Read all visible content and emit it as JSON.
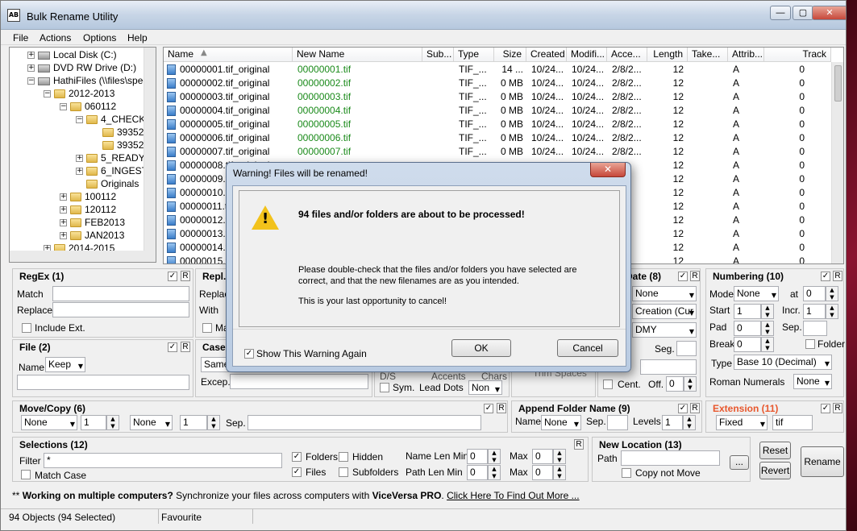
{
  "window": {
    "title": "Bulk Rename Utility",
    "icon_text": "AB",
    "controls": [
      "—",
      "▢",
      "✕"
    ]
  },
  "menu": [
    "File",
    "Actions",
    "Options",
    "Help"
  ],
  "tree": [
    {
      "label": "Local Disk (C:)",
      "type": "drive",
      "toggle": "+"
    },
    {
      "label": "DVD RW Drive (D:)",
      "type": "drive",
      "toggle": "+"
    },
    {
      "label": "HathiFiles (\\\\files\\spec",
      "type": "drive",
      "toggle": "−"
    },
    {
      "label": "2012-2013",
      "type": "folder",
      "toggle": "−"
    },
    {
      "label": "060112",
      "type": "folder",
      "toggle": "−"
    },
    {
      "label": "4_CHECK",
      "type": "folder",
      "toggle": "−"
    },
    {
      "label": "39352",
      "type": "folder",
      "toggle": ""
    },
    {
      "label": "39352",
      "type": "folder",
      "toggle": ""
    },
    {
      "label": "5_READY",
      "type": "folder",
      "toggle": "+"
    },
    {
      "label": "6_INGEST",
      "type": "folder",
      "toggle": "+"
    },
    {
      "label": "Originals",
      "type": "folder",
      "toggle": ""
    },
    {
      "label": "100112",
      "type": "folder",
      "toggle": "+"
    },
    {
      "label": "120112",
      "type": "folder",
      "toggle": "+"
    },
    {
      "label": "FEB2013",
      "type": "folder",
      "toggle": "+"
    },
    {
      "label": "JAN2013",
      "type": "folder",
      "toggle": "+"
    },
    {
      "label": "2014-2015",
      "type": "folder",
      "toggle": "+"
    }
  ],
  "columns": [
    "Name",
    "New Name",
    "Sub...",
    "Type",
    "Size",
    "Created",
    "Modifi...",
    "Acce...",
    "Length",
    "Take...",
    "Attrib...",
    "Track"
  ],
  "rows": [
    {
      "name": "00000001.tif_original",
      "new": "00000001.tif",
      "type": "TIF_...",
      "size": "14 ...",
      "created": "10/24...",
      "modified": "10/24...",
      "accessed": "2/8/2...",
      "length": "12",
      "attrib": "A",
      "track": "0"
    },
    {
      "name": "00000002.tif_original",
      "new": "00000002.tif",
      "type": "TIF_...",
      "size": "0 MB",
      "created": "10/24...",
      "modified": "10/24...",
      "accessed": "2/8/2...",
      "length": "12",
      "attrib": "A",
      "track": "0"
    },
    {
      "name": "00000003.tif_original",
      "new": "00000003.tif",
      "type": "TIF_...",
      "size": "0 MB",
      "created": "10/24...",
      "modified": "10/24...",
      "accessed": "2/8/2...",
      "length": "12",
      "attrib": "A",
      "track": "0"
    },
    {
      "name": "00000004.tif_original",
      "new": "00000004.tif",
      "type": "TIF_...",
      "size": "0 MB",
      "created": "10/24...",
      "modified": "10/24...",
      "accessed": "2/8/2...",
      "length": "12",
      "attrib": "A",
      "track": "0"
    },
    {
      "name": "00000005.tif_original",
      "new": "00000005.tif",
      "type": "TIF_...",
      "size": "0 MB",
      "created": "10/24...",
      "modified": "10/24...",
      "accessed": "2/8/2...",
      "length": "12",
      "attrib": "A",
      "track": "0"
    },
    {
      "name": "00000006.tif_original",
      "new": "00000006.tif",
      "type": "TIF_...",
      "size": "0 MB",
      "created": "10/24...",
      "modified": "10/24...",
      "accessed": "2/8/2...",
      "length": "12",
      "attrib": "A",
      "track": "0"
    },
    {
      "name": "00000007.tif_original",
      "new": "00000007.tif",
      "type": "TIF_...",
      "size": "0 MB",
      "created": "10/24...",
      "modified": "10/24...",
      "accessed": "2/8/2...",
      "length": "12",
      "attrib": "A",
      "track": "0"
    },
    {
      "name": "00000008.tif_original",
      "new": "",
      "type": "",
      "size": "",
      "created": "",
      "modified": "",
      "accessed": "",
      "length": "12",
      "attrib": "A",
      "track": "0"
    },
    {
      "name": "00000009.tif_original",
      "new": "",
      "type": "",
      "size": "",
      "created": "",
      "modified": "",
      "accessed": "",
      "length": "12",
      "attrib": "A",
      "track": "0"
    },
    {
      "name": "00000010.tif_original",
      "new": "",
      "type": "",
      "size": "",
      "created": "",
      "modified": "",
      "accessed": "",
      "length": "12",
      "attrib": "A",
      "track": "0"
    },
    {
      "name": "00000011.tif_original",
      "new": "",
      "type": "",
      "size": "",
      "created": "",
      "modified": "",
      "accessed": "",
      "length": "12",
      "attrib": "A",
      "track": "0"
    },
    {
      "name": "00000012.tif_original",
      "new": "",
      "type": "",
      "size": "",
      "created": "",
      "modified": "",
      "accessed": "",
      "length": "12",
      "attrib": "A",
      "track": "0"
    },
    {
      "name": "00000013.tif_original",
      "new": "",
      "type": "",
      "size": "",
      "created": "",
      "modified": "",
      "accessed": "",
      "length": "12",
      "attrib": "A",
      "track": "0"
    },
    {
      "name": "00000014.tif_original",
      "new": "",
      "type": "",
      "size": "",
      "created": "",
      "modified": "",
      "accessed": "",
      "length": "12",
      "attrib": "A",
      "track": "0"
    },
    {
      "name": "00000015.tif_original",
      "new": "",
      "type": "",
      "size": "",
      "created": "",
      "modified": "",
      "accessed": "",
      "length": "12",
      "attrib": "A",
      "track": "0"
    }
  ],
  "regex": {
    "title": "RegEx (1)",
    "match_label": "Match",
    "replace_label": "Replace",
    "include_ext": "Include Ext."
  },
  "repl": {
    "title": "Repl.",
    "replace_label": "Replac",
    "with_label": "With",
    "ma_label": "Ma"
  },
  "file": {
    "title": "File (2)",
    "name_label": "Name",
    "name_value": "Keep"
  },
  "case": {
    "title": "Case",
    "value": "Same",
    "except_label": "Excep."
  },
  "remove_frag": {
    "sym": "Sym.",
    "lead_dots": "Lead Dots",
    "lead_value": "Non",
    "dc": "D/S",
    "accents": "Accents",
    "chars": "Chars",
    "trim": "Trim Spaces"
  },
  "autodate": {
    "title": "Date (8)",
    "mode": "None",
    "type": "Creation (Cur",
    "fmt": "DMY",
    "seg_label": "Seg.",
    "cent": "Cent.",
    "off_label": "Off.",
    "off_value": "0"
  },
  "numbering": {
    "title": "Numbering (10)",
    "mode_label": "Mode",
    "mode_value": "None",
    "at_label": "at",
    "at_value": "0",
    "start_label": "Start",
    "start_value": "1",
    "incr_label": "Incr.",
    "incr_value": "1",
    "pad_label": "Pad",
    "pad_value": "0",
    "sep_label": "Sep.",
    "break_label": "Break",
    "break_value": "0",
    "folder_label": "Folder",
    "type_label": "Type",
    "type_value": "Base 10 (Decimal)",
    "roman_label": "Roman Numerals",
    "roman_value": "None"
  },
  "movecopy": {
    "title": "Move/Copy (6)",
    "sel1": "None",
    "num1": "1",
    "sel2": "None",
    "num2": "1",
    "sep_label": "Sep."
  },
  "append": {
    "title": "Append Folder Name (9)",
    "name_label": "Name",
    "name_value": "None",
    "sep_label": "Sep.",
    "levels_label": "Levels",
    "levels_value": "1"
  },
  "extension": {
    "title": "Extension (11)",
    "mode": "Fixed",
    "value": "tif"
  },
  "selections": {
    "title": "Selections (12)",
    "filter_label": "Filter",
    "filter_value": "*",
    "match_case": "Match Case",
    "folders": "Folders",
    "hidden": "Hidden",
    "files": "Files",
    "subfolders": "Subfolders",
    "name_min_label": "Name Len Min",
    "name_min": "0",
    "name_max_label": "Max",
    "name_max": "0",
    "path_min_label": "Path Len Min",
    "path_min": "0",
    "path_max_label": "Max",
    "path_max": "0"
  },
  "newloc": {
    "title": "New Location (13)",
    "path_label": "Path",
    "browse": "...",
    "copy_not_move": "Copy not Move"
  },
  "buttons": {
    "reset": "Reset",
    "revert": "Revert",
    "rename": "Rename",
    "r": "R"
  },
  "promo": {
    "stars": "**",
    "bold": "Working on multiple computers?",
    "text": " Synchronize your files across computers with ",
    "product": "ViceVersa PRO",
    "text2": ". ",
    "link": "Click Here To Find Out More ..."
  },
  "status": {
    "objects": "94 Objects (94 Selected)",
    "favourite": "Favourite"
  },
  "dialog": {
    "title": "Warning! Files will be renamed!",
    "close": "✕",
    "heading": "94 files and/or folders are about to be processed!",
    "body1": "Please double-check that the files and/or folders you have selected are",
    "body2": "correct, and that the new filenames are as you intended.",
    "body3": "This is your last opportunity to cancel!",
    "show_again": "Show This Warning Again",
    "ok": "OK",
    "cancel": "Cancel"
  },
  "colors": {
    "new_name": "#1a8a1a",
    "extension_title": "#e8572d"
  }
}
